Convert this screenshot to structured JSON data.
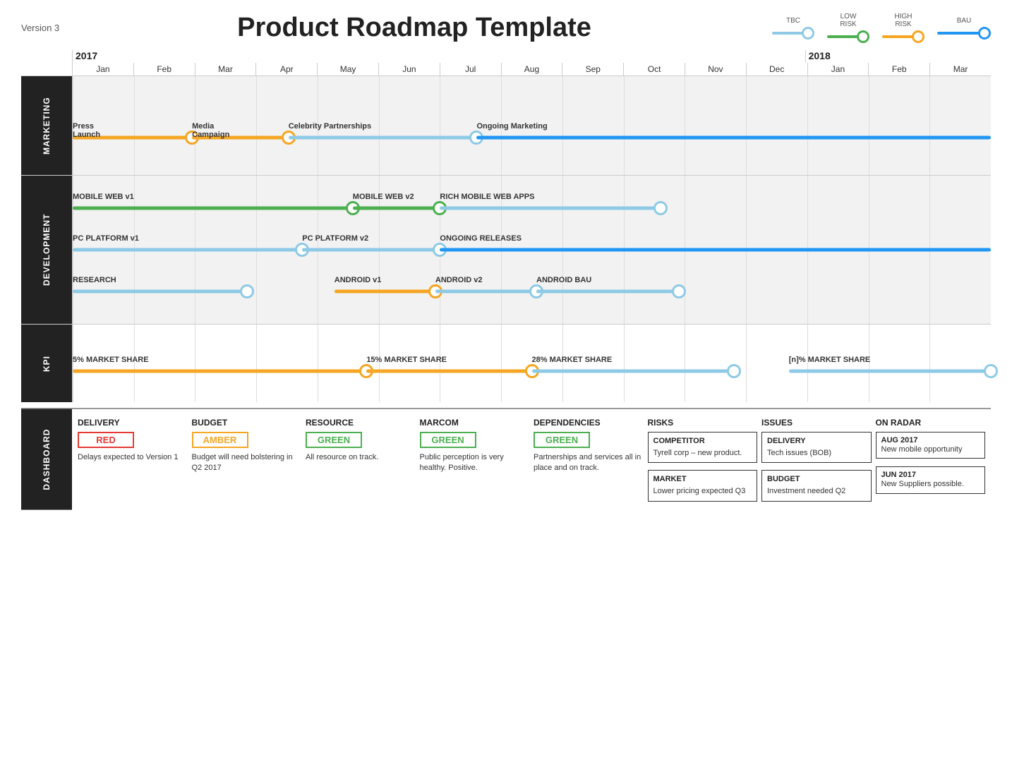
{
  "header": {
    "version": "Version 3",
    "title": "Product Roadmap Template"
  },
  "legend": [
    {
      "label": "TBC",
      "color": "#8ecae6",
      "trackColor": "#8ecae6"
    },
    {
      "label": "LOW\nRISK",
      "color": "#4caf50",
      "trackColor": "#4caf50"
    },
    {
      "label": "HIGH\nRISK",
      "color": "#f5a623",
      "trackColor": "#f5a623"
    },
    {
      "label": "BAU",
      "color": "#2196f3",
      "trackColor": "#2196f3"
    }
  ],
  "years": [
    "2017",
    "2018"
  ],
  "months": [
    "Jan",
    "Feb",
    "Mar",
    "Apr",
    "May",
    "Jun",
    "Jul",
    "Aug",
    "Sep",
    "Oct",
    "Nov",
    "Dec",
    "Jan",
    "Feb",
    "Mar"
  ],
  "sections": {
    "marketing": {
      "label": "MARKETING",
      "tracks": [
        {
          "label": "Press\nLaunch",
          "color": "#f5a623",
          "start": 0.0,
          "end": 0.12,
          "dot_end": 0.12,
          "labelPos": "start"
        },
        {
          "label": "Media\nCampaign",
          "color": "#f5a623",
          "start": 0.12,
          "end": 0.235,
          "dot_end": 0.235,
          "labelPos": "start"
        },
        {
          "label": "Celebrity Partnerships",
          "color": "#8ecae6",
          "start": 0.235,
          "end": 0.44,
          "dot_end": 0.44,
          "labelPos": "middle"
        },
        {
          "label": "Ongoing Marketing",
          "color": "#2196f3",
          "start": 0.44,
          "end": 1.0,
          "dot_end": null,
          "labelPos": "start"
        }
      ]
    },
    "development": {
      "label": "DEVELOPMENT",
      "tracks": [
        {
          "row": 0,
          "label": "MOBILE WEB v1",
          "color": "#4caf50",
          "start": 0.0,
          "end": 0.305,
          "dot_end": 0.305,
          "labelPos": "start"
        },
        {
          "row": 0,
          "label": "MOBILE WEB v2",
          "color": "#4caf50",
          "start": 0.305,
          "end": 0.395,
          "dot_end": 0.395,
          "labelPos": "start"
        },
        {
          "row": 0,
          "label": "RICH MOBILE WEB APPS",
          "color": "#8ecae6",
          "start": 0.395,
          "end": 0.64,
          "dot_end": 0.64,
          "labelPos": "start"
        },
        {
          "row": 1,
          "label": "PC PLATFORM v1",
          "color": "#8ecae6",
          "start": 0.0,
          "end": 0.253,
          "dot_end": 0.253,
          "labelPos": "start"
        },
        {
          "row": 1,
          "label": "PC PLATFORM v2",
          "color": "#8ecae6",
          "start": 0.253,
          "end": 0.395,
          "dot_end": 0.395,
          "labelPos": "start"
        },
        {
          "row": 1,
          "label": "ONGOING RELEASES",
          "color": "#2196f3",
          "start": 0.395,
          "end": 1.0,
          "dot_end": null,
          "labelPos": "start"
        },
        {
          "row": 2,
          "label": "RESEARCH",
          "color": "#8ecae6",
          "start": 0.0,
          "end": 0.19,
          "dot_end": 0.19,
          "labelPos": "start"
        },
        {
          "row": 2,
          "label": "ANDROID v1",
          "color": "#f5a623",
          "start": 0.285,
          "end": 0.395,
          "dot_end": 0.395,
          "labelPos": "start"
        },
        {
          "row": 2,
          "label": "ANDROID v2",
          "color": "#8ecae6",
          "start": 0.395,
          "end": 0.505,
          "dot_end": 0.505,
          "labelPos": "start"
        },
        {
          "row": 2,
          "label": "ANDROID BAU",
          "color": "#8ecae6",
          "start": 0.505,
          "end": 0.66,
          "dot_end": 0.66,
          "labelPos": "start"
        }
      ]
    },
    "kpi": {
      "label": "KPI",
      "tracks": [
        {
          "label": "5% MARKET SHARE",
          "color": "#f5a623",
          "start": 0.0,
          "end": 0.32,
          "dot_end": 0.32,
          "labelPos": "start"
        },
        {
          "label": "15% MARKET SHARE",
          "color": "#f5a623",
          "start": 0.32,
          "end": 0.5,
          "dot_end": 0.5,
          "labelPos": "start"
        },
        {
          "label": "28% MARKET SHARE",
          "color": "#8ecae6",
          "start": 0.5,
          "end": 0.72,
          "dot_end": 0.72,
          "labelPos": "start"
        },
        {
          "label": "[n]% MARKET SHARE",
          "color": "#8ecae6",
          "start": 0.78,
          "end": 1.0,
          "dot_end": 1.0,
          "labelPos": "start"
        }
      ]
    }
  },
  "dashboard": {
    "delivery": {
      "title": "DELIVERY",
      "status": "RED",
      "statusColor": "#e53935",
      "text": "Delays expected to Version 1"
    },
    "budget": {
      "title": "BUDGET",
      "status": "AMBER",
      "statusColor": "#f5a623",
      "text": "Budget will need bolstering in Q2 2017"
    },
    "resource": {
      "title": "RESOURCE",
      "status": "GREEN",
      "statusColor": "#4caf50",
      "text": "All resource on track."
    },
    "marcom": {
      "title": "MARCOM",
      "status": "GREEN",
      "statusColor": "#4caf50",
      "text": "Public perception is very healthy. Positive."
    },
    "dependencies": {
      "title": "DEPENDENCIES",
      "status": "GREEN",
      "statusColor": "#4caf50",
      "text": "Partnerships and services all in place and on track."
    },
    "risks": {
      "title": "RISKS",
      "items": [
        {
          "title": "COMPETITOR",
          "text": "Tyrell corp – new product."
        },
        {
          "title": "MARKET",
          "text": "Lower pricing expected Q3"
        }
      ]
    },
    "issues": {
      "title": "ISSUES",
      "items": [
        {
          "title": "DELIVERY",
          "text": "Tech issues (BOB)"
        },
        {
          "title": "BUDGET",
          "text": "Investment needed Q2"
        }
      ]
    },
    "onRadar": {
      "title": "ON RADAR",
      "items": [
        {
          "date": "AUG 2017",
          "text": "New mobile opportunity"
        },
        {
          "date": "JUN 2017",
          "text": "New Suppliers possible."
        }
      ]
    }
  }
}
